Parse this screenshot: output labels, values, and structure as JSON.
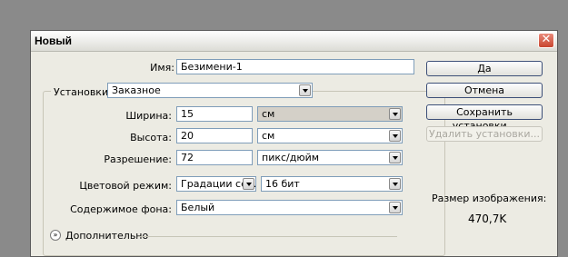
{
  "window": {
    "title": "Новый",
    "close_glyph": "✕"
  },
  "form": {
    "name_label": "Имя:",
    "name_value": "Безимени-1",
    "preset_label": "Установки:",
    "preset_value": "Заказное",
    "width_label": "Ширина:",
    "width_value": "15",
    "width_unit": "см",
    "height_label": "Высота:",
    "height_value": "20",
    "height_unit": "см",
    "resolution_label": "Разрешение:",
    "resolution_value": "72",
    "resolution_unit": "пикс/дюйм",
    "color_mode_label": "Цветовой режим:",
    "color_mode_value": "Градации се...",
    "bit_depth_value": "16 бит",
    "background_label": "Содержимое фона:",
    "background_value": "Белый",
    "advanced_label": "Дополнительно"
  },
  "buttons": {
    "ok": "Да",
    "cancel": "Отмена",
    "save_preset": "Сохранить установки...",
    "delete_preset": "Удалить установки..."
  },
  "info": {
    "image_size_label": "Размер изображения:",
    "image_size_value": "470,7K"
  },
  "icons": {
    "close": "close-icon",
    "dropdown": "chevron-down-icon",
    "advanced": "double-chevron-down-icon"
  }
}
